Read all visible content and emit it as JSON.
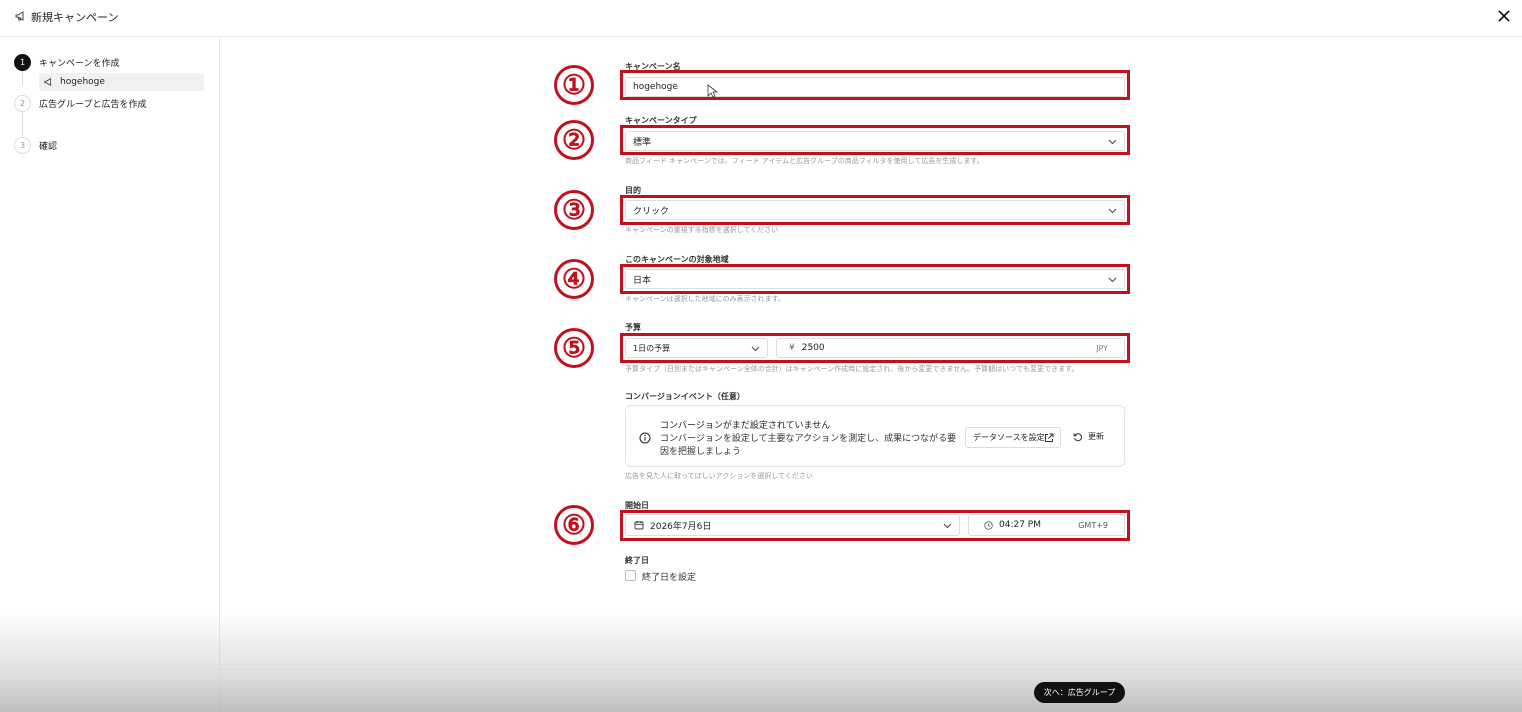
{
  "header": {
    "title": "新規キャンペーン",
    "icon": "megaphone-icon",
    "close_icon": "close-icon"
  },
  "sidebar": {
    "steps": [
      {
        "number": "1",
        "label": "キャンペーンを作成",
        "active": true
      },
      {
        "number": "2",
        "label": "広告グループと広告を作成",
        "active": false
      },
      {
        "number": "3",
        "label": "確認",
        "active": false
      }
    ],
    "subitem": {
      "label": "hogehoge",
      "icon": "megaphone-icon"
    }
  },
  "form": {
    "campaign_name": {
      "label": "キャンペーン名",
      "value": "hogehoge"
    },
    "campaign_type": {
      "label": "キャンペーンタイプ",
      "value": "標準",
      "help": "商品フィード キャンペーンでは、フィード アイテムと広告グループの商品フィルタを使用して広告を生成します。"
    },
    "objective": {
      "label": "目的",
      "value": "クリック",
      "help": "キャンペーンの重視する指標を選択してください"
    },
    "region": {
      "label": "このキャンペーンの対象地域",
      "value": "日本",
      "help": "キャンペーンは選択した地域にのみ表示されます。"
    },
    "budget": {
      "label": "予算",
      "type_value": "1日の予算",
      "currency_symbol": "¥",
      "amount": "2500",
      "currency": "JPY",
      "help": "予算タイプ（日別またはキャンペーン全体の合計）はキャンペーン作成時に設定され、後から変更できません。予算額はいつでも変更できます。"
    },
    "conversion": {
      "label": "コンバージョンイベント（任意）",
      "title": "コンバージョンがまだ設定されていません",
      "desc": "コンバージョンを設定して主要なアクションを測定し、成果につながる要因を把握しましょう",
      "datasource_button": "データソースを設定",
      "refresh_button": "更新",
      "help": "広告を見た人に取ってほしいアクションを選択してください"
    },
    "start_date": {
      "label": "開始日",
      "date": "2026年7月6日",
      "time": "04:27 PM",
      "timezone": "GMT+9"
    },
    "end_date": {
      "label": "終了日",
      "checkbox_label": "終了日を設定"
    }
  },
  "annotations": [
    "①",
    "②",
    "③",
    "④",
    "⑤",
    "⑥"
  ],
  "annotation_color": "#c0121c",
  "footer": {
    "next_button": "次へ：広告グループ"
  }
}
